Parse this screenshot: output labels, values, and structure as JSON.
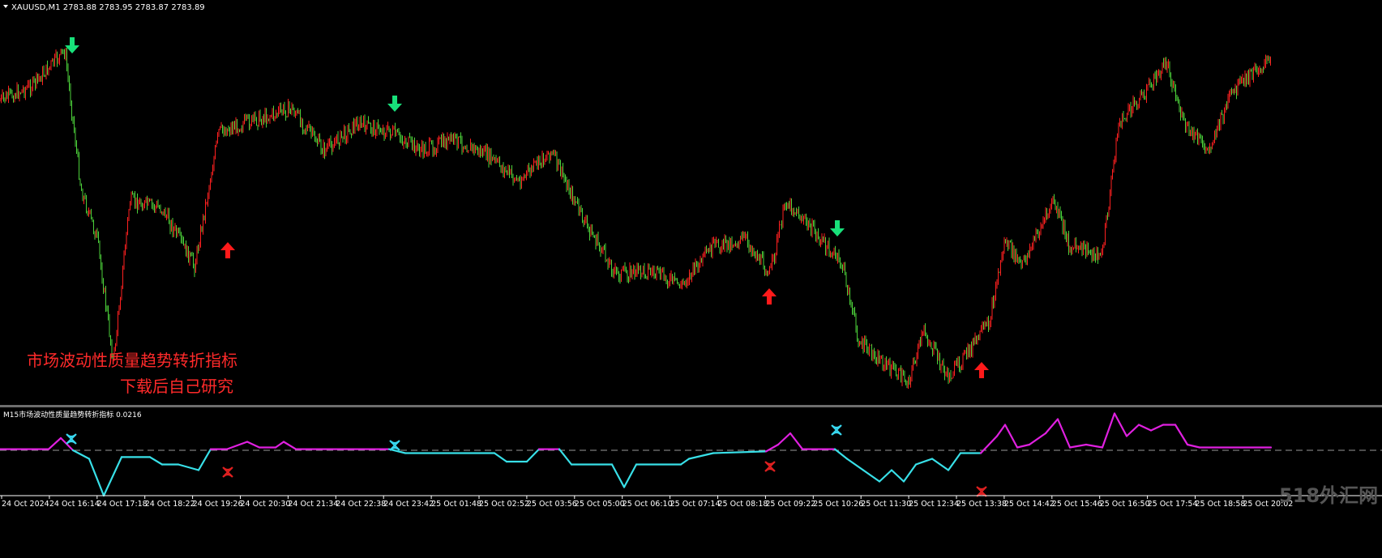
{
  "window": {
    "symbol_header": "XAUUSD,M1  2783.88 2783.95 2783.87 2783.89",
    "colors": {
      "background": "#000000",
      "bull": "#ff2020",
      "bear": "#4cd13a",
      "separator": "#7a7a7a"
    }
  },
  "annotation": {
    "line1": "市场波动性质量趋势转折指标",
    "line2": "下载后自己研究",
    "color": "#ff2a2a"
  },
  "indicator": {
    "header": "M15市场波动性质量趋势转折指标 0.0216",
    "up_color": "#e020e0",
    "down_color": "#38e0e8",
    "zero_line_color": "#9a9a9a"
  },
  "time_axis": {
    "labels": [
      "24 Oct 2024",
      "24 Oct 16:14",
      "24 Oct 17:18",
      "24 Oct 18:22",
      "24 Oct 19:26",
      "24 Oct 20:30",
      "24 Oct 21:34",
      "24 Oct 22:38",
      "24 Oct 23:42",
      "25 Oct 01:48",
      "25 Oct 02:52",
      "25 Oct 03:56",
      "25 Oct 05:00",
      "25 Oct 06:10",
      "25 Oct 07:14",
      "25 Oct 08:18",
      "25 Oct 09:22",
      "25 Oct 10:26",
      "25 Oct 11:30",
      "25 Oct 12:34",
      "25 Oct 13:38",
      "25 Oct 14:42",
      "25 Oct 15:46",
      "25 Oct 16:50",
      "25 Oct 17:54",
      "25 Oct 18:58",
      "25 Oct 20:02"
    ]
  },
  "watermark": "518外汇网",
  "chart_data": {
    "type": "line",
    "x_axis": "time (M1 bars, labels every 64 min)",
    "series": [
      {
        "name": "XAUUSD,M1",
        "price_path_relative": [
          [
            0,
            0.78
          ],
          [
            40,
            0.82
          ],
          [
            80,
            0.91
          ],
          [
            100,
            0.55
          ],
          [
            120,
            0.42
          ],
          [
            140,
            0.1
          ],
          [
            160,
            0.52
          ],
          [
            200,
            0.5
          ],
          [
            240,
            0.35
          ],
          [
            270,
            0.7
          ],
          [
            300,
            0.72
          ],
          [
            360,
            0.76
          ],
          [
            400,
            0.65
          ],
          [
            440,
            0.72
          ],
          [
            480,
            0.7
          ],
          [
            520,
            0.65
          ],
          [
            560,
            0.68
          ],
          [
            600,
            0.64
          ],
          [
            640,
            0.57
          ],
          [
            680,
            0.65
          ],
          [
            720,
            0.47
          ],
          [
            760,
            0.33
          ],
          [
            800,
            0.34
          ],
          [
            840,
            0.3
          ],
          [
            880,
            0.4
          ],
          [
            920,
            0.42
          ],
          [
            950,
            0.33
          ],
          [
            970,
            0.52
          ],
          [
            1000,
            0.45
          ],
          [
            1040,
            0.35
          ],
          [
            1060,
            0.15
          ],
          [
            1120,
            0.05
          ],
          [
            1140,
            0.18
          ],
          [
            1170,
            0.06
          ],
          [
            1220,
            0.2
          ],
          [
            1240,
            0.42
          ],
          [
            1260,
            0.35
          ],
          [
            1300,
            0.52
          ],
          [
            1320,
            0.4
          ],
          [
            1360,
            0.38
          ],
          [
            1380,
            0.72
          ],
          [
            1420,
            0.82
          ],
          [
            1440,
            0.88
          ],
          [
            1460,
            0.72
          ],
          [
            1490,
            0.65
          ],
          [
            1520,
            0.8
          ],
          [
            1560,
            0.88
          ],
          [
            1568,
            0.88
          ]
        ]
      },
      {
        "name": "M15市场波动性质量趋势转折指标",
        "points": [
          [
            0,
            0.002
          ],
          [
            60,
            0.002
          ],
          [
            75,
            0.0216
          ],
          [
            90,
            0.0
          ],
          [
            110,
            -0.015
          ],
          [
            128,
            -0.08
          ],
          [
            150,
            -0.012
          ],
          [
            185,
            -0.012
          ],
          [
            200,
            -0.025
          ],
          [
            220,
            -0.025
          ],
          [
            245,
            -0.035
          ],
          [
            260,
            0.002
          ],
          [
            280,
            0.002
          ],
          [
            305,
            0.015
          ],
          [
            320,
            0.005
          ],
          [
            340,
            0.005
          ],
          [
            350,
            0.015
          ],
          [
            365,
            0.002
          ],
          [
            480,
            0.002
          ],
          [
            500,
            -0.005
          ],
          [
            610,
            -0.005
          ],
          [
            625,
            -0.02
          ],
          [
            650,
            -0.02
          ],
          [
            665,
            0.002
          ],
          [
            690,
            0.002
          ],
          [
            705,
            -0.025
          ],
          [
            755,
            -0.025
          ],
          [
            770,
            -0.065
          ],
          [
            785,
            -0.025
          ],
          [
            840,
            -0.025
          ],
          [
            850,
            -0.015
          ],
          [
            880,
            -0.005
          ],
          [
            945,
            -0.002
          ],
          [
            960,
            0.01
          ],
          [
            975,
            0.03
          ],
          [
            990,
            0.002
          ],
          [
            1030,
            0.002
          ],
          [
            1045,
            -0.015
          ],
          [
            1065,
            -0.035
          ],
          [
            1085,
            -0.055
          ],
          [
            1100,
            -0.035
          ],
          [
            1115,
            -0.055
          ],
          [
            1130,
            -0.025
          ],
          [
            1150,
            -0.015
          ],
          [
            1170,
            -0.035
          ],
          [
            1185,
            -0.005
          ],
          [
            1210,
            -0.005
          ],
          [
            1230,
            0.025
          ],
          [
            1240,
            0.045
          ],
          [
            1255,
            0.005
          ],
          [
            1270,
            0.01
          ],
          [
            1290,
            0.03
          ],
          [
            1305,
            0.055
          ],
          [
            1320,
            0.005
          ],
          [
            1340,
            0.01
          ],
          [
            1360,
            0.005
          ],
          [
            1375,
            0.065
          ],
          [
            1390,
            0.025
          ],
          [
            1405,
            0.045
          ],
          [
            1420,
            0.035
          ],
          [
            1435,
            0.045
          ],
          [
            1450,
            0.045
          ],
          [
            1465,
            0.01
          ],
          [
            1480,
            0.005
          ],
          [
            1568,
            0.005
          ]
        ]
      }
    ],
    "signals": {
      "price_up_arrows": [
        [
          281,
          309
        ],
        [
          949,
          366
        ],
        [
          1211,
          457
        ]
      ],
      "price_down_arrows": [
        [
          89,
          56
        ],
        [
          487,
          128
        ],
        [
          1033,
          282
        ]
      ],
      "indicator_cross_up": [
        [
          88,
          542
        ],
        [
          487,
          550
        ],
        [
          1032,
          531
        ]
      ],
      "indicator_cross_down": [
        [
          281,
          583
        ],
        [
          950,
          576
        ],
        [
          1211,
          607
        ]
      ]
    }
  }
}
